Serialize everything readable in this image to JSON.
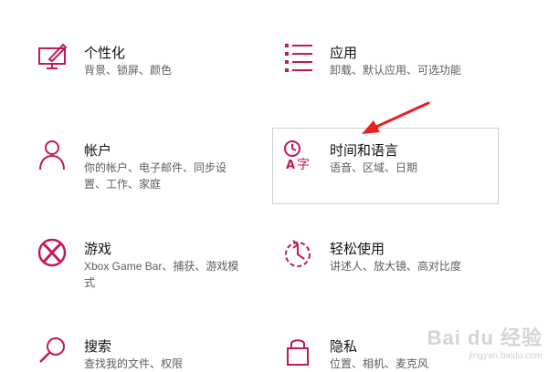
{
  "accent": "#c3185a",
  "tiles": [
    {
      "id": "personalization",
      "title": "个性化",
      "desc": "背景、锁屏、颜色",
      "icon": "paint-monitor-icon"
    },
    {
      "id": "apps",
      "title": "应用",
      "desc": "卸载、默认应用、可选功能",
      "icon": "app-list-icon"
    },
    {
      "id": "accounts",
      "title": "帐户",
      "desc": "你的帐户、电子邮件、同步设置、工作、家庭",
      "icon": "person-icon"
    },
    {
      "id": "time-language",
      "title": "时间和语言",
      "desc": "语音、区域、日期",
      "icon": "time-language-icon"
    },
    {
      "id": "gaming",
      "title": "游戏",
      "desc": "Xbox Game Bar、捕获、游戏模式",
      "icon": "xbox-icon"
    },
    {
      "id": "ease-of-access",
      "title": "轻松使用",
      "desc": "讲述人、放大镜、高对比度",
      "icon": "ease-of-access-icon"
    },
    {
      "id": "search",
      "title": "搜索",
      "desc": "查找我的文件、权限",
      "icon": "search-icon"
    },
    {
      "id": "privacy",
      "title": "隐私",
      "desc": "位置、相机、麦克风",
      "icon": "lock-icon"
    }
  ],
  "watermark": {
    "brand": "Bai du 经验",
    "url": "jingyan.baidu.com"
  }
}
